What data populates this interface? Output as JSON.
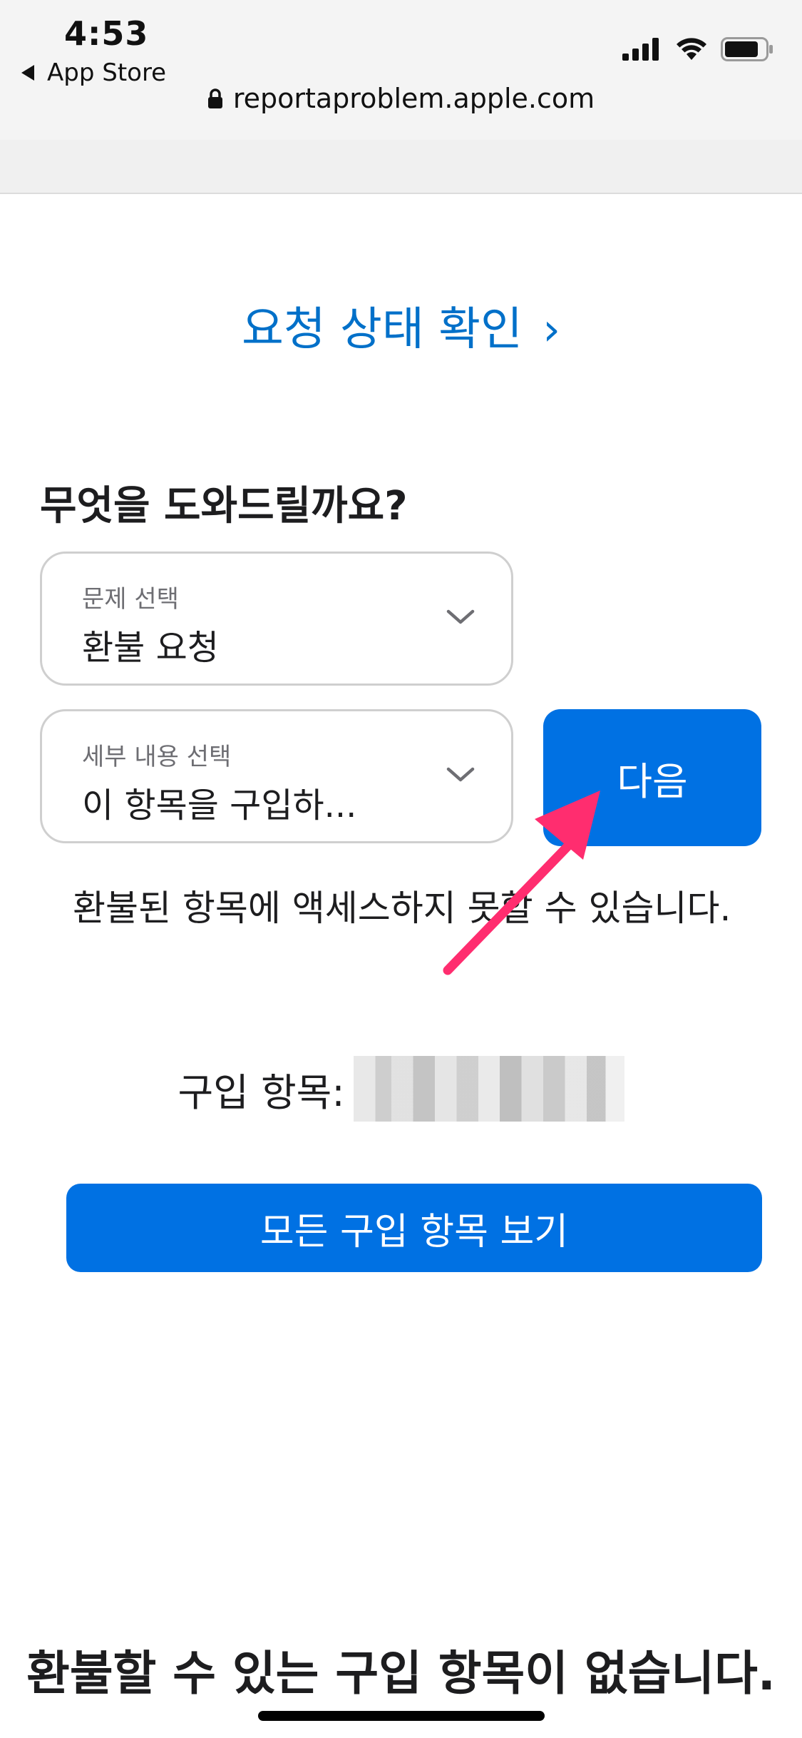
{
  "status_bar": {
    "time": "4:53",
    "back_app": "App Store",
    "url": "reportaproblem.apple.com"
  },
  "links": {
    "check_status": "요청 상태 확인",
    "check_status_chevron": "›"
  },
  "form": {
    "heading": "무엇을 도와드릴까요?",
    "issue_select": {
      "label": "문제 선택",
      "value": "환불 요청"
    },
    "detail_select": {
      "label": "세부 내용 선택",
      "value": "이 항목을 구입하..."
    },
    "next_label": "다음"
  },
  "notice": "환불된 항목에 액세스하지 못할 수 있습니다.",
  "purchase": {
    "label": "구입 항목:"
  },
  "all_purchases_label": "모든 구입 항목 보기",
  "bottom_title": "환불할 수 있는 구입 항목이 없습니다.",
  "colors": {
    "accent": "#0071e3",
    "link": "#0070c9",
    "annotation": "#ff2d6f"
  }
}
